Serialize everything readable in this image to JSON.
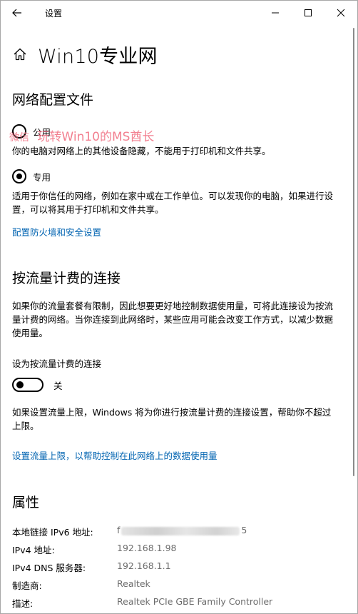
{
  "window": {
    "title": "设置"
  },
  "header": {
    "title": "Win10专业网"
  },
  "watermark": {
    "prefix": "微信",
    "text": "玩转Win10的MS酋长"
  },
  "network_profile": {
    "heading": "网络配置文件",
    "options": [
      {
        "label": "公用",
        "checked": false,
        "description": "你的电脑对网络上的其他设备隐藏，不能用于打印机和文件共享。"
      },
      {
        "label": "专用",
        "checked": true,
        "description": "适用于你信任的网络，例如在家中或在工作单位。可以发现你的电脑，如果进行设置，可以将其用于打印机和文件共享。"
      }
    ],
    "firewall_link": "配置防火墙和安全设置"
  },
  "metered": {
    "heading": "按流量计费的连接",
    "description": "如果你的流量套餐有限制，因此想要更好地控制数据使用量，可将此连接设为按流量计费的网络。当你连接到此网络时，某些应用可能会改变工作方式，以减少数据使用量。",
    "toggle_label": "设为按流量计费的连接",
    "toggle_state": "关",
    "toggle_on": false,
    "limit_text": "如果设置流量上限，Windows 将为你进行按流量计费的连接设置，帮助你不超过上限。",
    "limit_link": "设置流量上限，以帮助控制在此网络上的数据使用量"
  },
  "properties": {
    "heading": "属性",
    "rows": [
      {
        "key": "本地链接 IPv6 地址:",
        "value_start": "f",
        "value_end": "5"
      },
      {
        "key": "IPv4 地址:",
        "value": "192.168.1.98"
      },
      {
        "key": "IPv4 DNS 服务器:",
        "value": "192.168.1.1"
      },
      {
        "key": "制造商:",
        "value": "Realtek"
      },
      {
        "key": "描述:",
        "value": "Realtek PCIe GBE Family Controller"
      }
    ]
  },
  "colors": {
    "link": "#0063b1",
    "watermark": "#f06a7d",
    "value_gray": "#6b6b6b"
  },
  "icons": {
    "back": "back-arrow-icon",
    "minimize": "minimize-icon",
    "maximize": "maximize-icon",
    "close": "close-icon",
    "home": "home-icon"
  }
}
